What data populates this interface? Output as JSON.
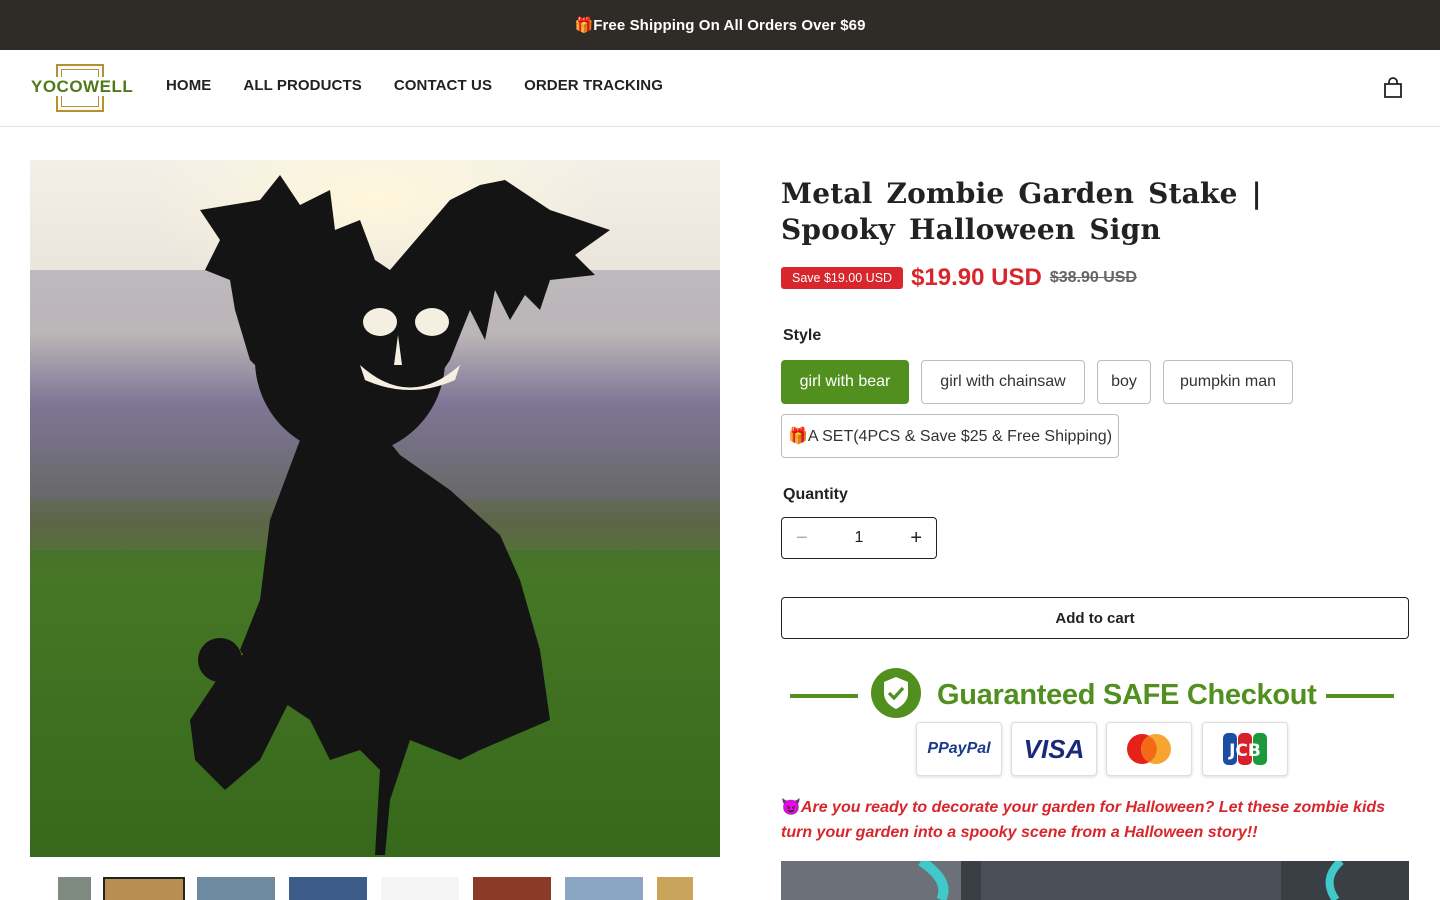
{
  "announcement": {
    "text": "🎁Free Shipping On All Orders Over $69"
  },
  "header": {
    "logo_text": "YOCOWELL",
    "nav": [
      "HOME",
      "ALL PRODUCTS",
      "CONTACT US",
      "ORDER TRACKING"
    ],
    "cart_icon": "shopping-bag-icon"
  },
  "product": {
    "title": "Metal Zombie Garden Stake | Spooky Halloween Sign",
    "save_badge": "Save $19.00 USD",
    "price": "$19.90 USD",
    "compare_price": "$38.90 USD",
    "style_label": "Style",
    "options": [
      "girl with bear",
      "girl with chainsaw",
      "boy",
      "pumpkin man",
      "🎁A SET(4PCS & Save $25 & Free Shipping)"
    ],
    "selected_option": "girl with bear",
    "quantity_label": "Quantity",
    "quantity": "1",
    "add_to_cart": "Add to cart",
    "promo_emoji": "😈",
    "promo_text": "Are you ready to decorate your garden for Halloween? Let these zombie kids turn your garden into a spooky scene from a Halloween story!!"
  },
  "trust_badge": {
    "title": "Guaranteed SAFE Checkout",
    "payments": [
      "PayPal",
      "VISA",
      "Mastercard",
      "JCB"
    ]
  },
  "colors": {
    "announcement_bg": "#2f2b27",
    "accent_green": "#51901f",
    "sale_red": "#d8262c",
    "logo_gold": "#b8902e"
  }
}
